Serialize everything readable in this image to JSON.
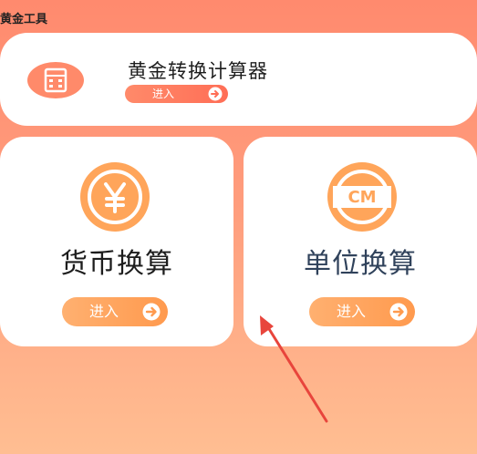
{
  "header": {
    "app_title": "黄金工具"
  },
  "top_card": {
    "title": "黄金转换计算器",
    "button_label": "进入",
    "icon": "calculator-icon"
  },
  "cards": {
    "currency": {
      "title": "货币换算",
      "button_label": "进入",
      "icon": "yen-icon"
    },
    "unit": {
      "title": "单位换算",
      "button_label": "进入",
      "icon_text": "CM",
      "icon": "cm-ruler-icon"
    }
  },
  "colors": {
    "bg_top": "#ff8a6e",
    "bg_bottom": "#ffbe92",
    "accent_orange": "#ff9a4e",
    "accent_red": "#ff6e56",
    "annotation_arrow": "#e8453c"
  }
}
